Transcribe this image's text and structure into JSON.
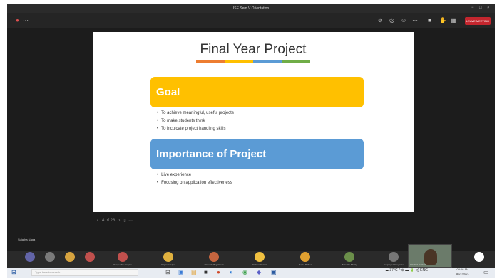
{
  "window": {
    "title": "ISE Sem V Orientation",
    "min": "−",
    "max": "□",
    "close": "×"
  },
  "toolbar": {
    "left_icon": "●",
    "left_dots": "···",
    "icons": [
      "⊜",
      "◎",
      "☺",
      "···",
      "■",
      "✋",
      "▦"
    ],
    "leave_label": "LEAVE MEETING"
  },
  "slide": {
    "title": "Final Year Project",
    "title_underline_colors": [
      "#ed7d31",
      "#ffc000",
      "#5b9bd5",
      "#70ad47"
    ],
    "goal_heading": "Goal",
    "goal_bullets": [
      "To achieve meaningful, useful projects",
      "To make students think",
      "To inculcate project handling skills"
    ],
    "importance_heading": "Importance of Project",
    "importance_bullets": [
      "Live experience",
      "Focusing on application effectiveness"
    ]
  },
  "slide_nav": {
    "prev": "‹",
    "page": "4 of 28",
    "next": "›",
    "notes": "▯",
    "more": "···"
  },
  "presenter_label": "Sujatha Naga",
  "participants": [
    {
      "name": "",
      "color": "#6264a7"
    },
    {
      "name": "",
      "color": "#7a7a7a"
    },
    {
      "name": "",
      "color": "#d6a33f"
    },
    {
      "name": "",
      "color": "#c0504d"
    },
    {
      "name": "Sangeetha Singam",
      "color": "#c0504d"
    },
    {
      "name": "Rajasekar Iyer",
      "color": "#e0b13f"
    },
    {
      "name": "Ramesh Mogalapuri",
      "color": "#c5653f"
    },
    {
      "name": "Kishore Kumar",
      "color": "#f0c040"
    },
    {
      "name": "Rajan Rathor",
      "color": "#e0a030"
    },
    {
      "name": "Surekha Shetty",
      "color": "#6b8f4a"
    },
    {
      "name": "Soujanya Narayanan",
      "color": "#777777"
    },
    {
      "name": "",
      "color": "#ffffff"
    }
  ],
  "video_participant": "Lakshmi Hoskeri",
  "taskbar": {
    "start": "⊞",
    "search_placeholder": "Type here to search",
    "apps": [
      "⊞",
      "▣",
      "▤",
      "■",
      "●",
      "◐",
      "◉",
      "◆",
      "▣"
    ],
    "tray": "☁ 37°C  ^  ⊕ ▬ 🔋 ◁) ENG",
    "time": "03:16 AM",
    "date": "8/27/2021",
    "notify": "▭"
  }
}
